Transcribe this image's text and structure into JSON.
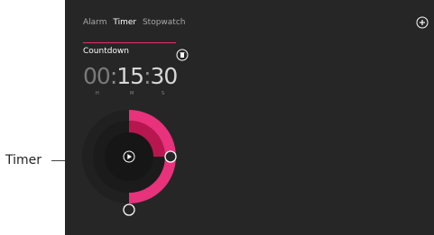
{
  "annotation": {
    "label": "Timer"
  },
  "nav": {
    "tabs": [
      {
        "label": "Alarm"
      },
      {
        "label": "Timer"
      },
      {
        "label": "Stopwatch"
      }
    ],
    "active": "Timer"
  },
  "timer": {
    "name": "Countdown",
    "hours": "00",
    "minutes": "15",
    "seconds": "30",
    "unit_hours": "H",
    "unit_minutes": "M",
    "unit_seconds": "S",
    "set_fraction_outer": 0.5,
    "set_fraction_inner": 0.25
  },
  "colors": {
    "accent": "#e8327b",
    "accent_dark": "#b8164f",
    "background": "#262626"
  },
  "icons": {
    "add": "plus-circle-icon",
    "reset": "trash-icon",
    "play": "play-icon"
  }
}
